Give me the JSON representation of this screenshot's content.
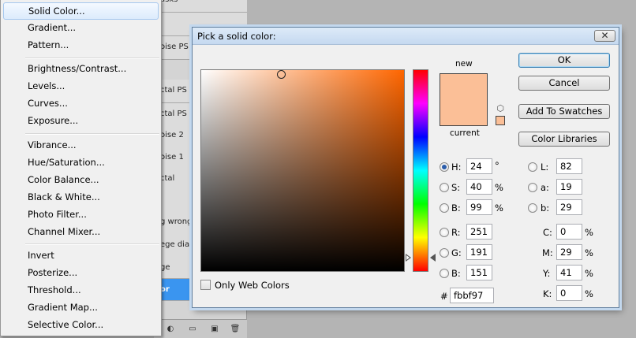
{
  "layers_panel": {
    "rows": [
      {
        "label": "asks"
      },
      {
        "label": ""
      },
      {
        "label": "oise PS la"
      },
      {
        "label": "ctal PS lay"
      },
      {
        "label": "ctal PS La"
      },
      {
        "label": "oise 2"
      },
      {
        "label": "oise 1"
      },
      {
        "label": "ctal"
      },
      {
        "label": ""
      },
      {
        "label": "g wrong"
      },
      {
        "label": "ege dialo"
      },
      {
        "label": "ge"
      },
      {
        "label": "or"
      }
    ],
    "footer_icons": [
      "◐",
      "▭",
      "▣",
      "🗑"
    ]
  },
  "menu": {
    "items": [
      {
        "label": "Solid Color..."
      },
      {
        "label": "Gradient..."
      },
      {
        "label": "Pattern..."
      },
      {
        "label": "Brightness/Contrast..."
      },
      {
        "label": "Levels..."
      },
      {
        "label": "Curves..."
      },
      {
        "label": "Exposure..."
      },
      {
        "label": "Vibrance..."
      },
      {
        "label": "Hue/Saturation..."
      },
      {
        "label": "Color Balance..."
      },
      {
        "label": "Black & White..."
      },
      {
        "label": "Photo Filter..."
      },
      {
        "label": "Channel Mixer..."
      },
      {
        "label": "Invert"
      },
      {
        "label": "Posterize..."
      },
      {
        "label": "Threshold..."
      },
      {
        "label": "Gradient Map..."
      },
      {
        "label": "Selective Color..."
      }
    ]
  },
  "dialog": {
    "title": "Pick a solid color:",
    "close_glyph": "✕",
    "new_label": "new",
    "current_label": "current",
    "new_color": "#fbbf97",
    "current_color": "#fbbf97",
    "buttons": {
      "ok": "OK",
      "cancel": "Cancel",
      "add_swatches": "Add To Swatches",
      "libraries": "Color Libraries"
    },
    "hsb": {
      "h": {
        "label": "H:",
        "value": "24",
        "unit": "°"
      },
      "s": {
        "label": "S:",
        "value": "40",
        "unit": "%"
      },
      "b": {
        "label": "B:",
        "value": "99",
        "unit": "%"
      }
    },
    "rgb": {
      "r": {
        "label": "R:",
        "value": "251"
      },
      "g": {
        "label": "G:",
        "value": "191"
      },
      "b": {
        "label": "B:",
        "value": "151"
      }
    },
    "lab": {
      "l": {
        "label": "L:",
        "value": "82"
      },
      "a": {
        "label": "a:",
        "value": "19"
      },
      "b": {
        "label": "b:",
        "value": "29"
      }
    },
    "cmyk": {
      "c": {
        "label": "C:",
        "value": "0",
        "unit": "%"
      },
      "m": {
        "label": "M:",
        "value": "29",
        "unit": "%"
      },
      "y": {
        "label": "Y:",
        "value": "41",
        "unit": "%"
      },
      "k": {
        "label": "K:",
        "value": "0",
        "unit": "%"
      }
    },
    "hex_label": "#",
    "hex_value": "fbbf97",
    "web_colors_label": "Only Web Colors"
  }
}
